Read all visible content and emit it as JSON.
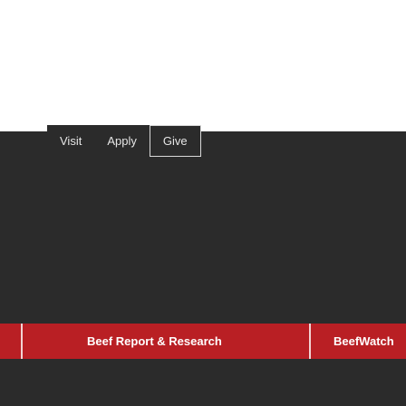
{
  "nav": {
    "items": [
      "Visit",
      "Apply",
      "Give"
    ],
    "active_index": 2
  },
  "red_bar": {
    "tabs": [
      "Beef Report & Research",
      "BeefWatch"
    ]
  },
  "colors": {
    "dark_background": "#2b2b2b",
    "accent_red": "#b91f24",
    "white": "#ffffff"
  }
}
